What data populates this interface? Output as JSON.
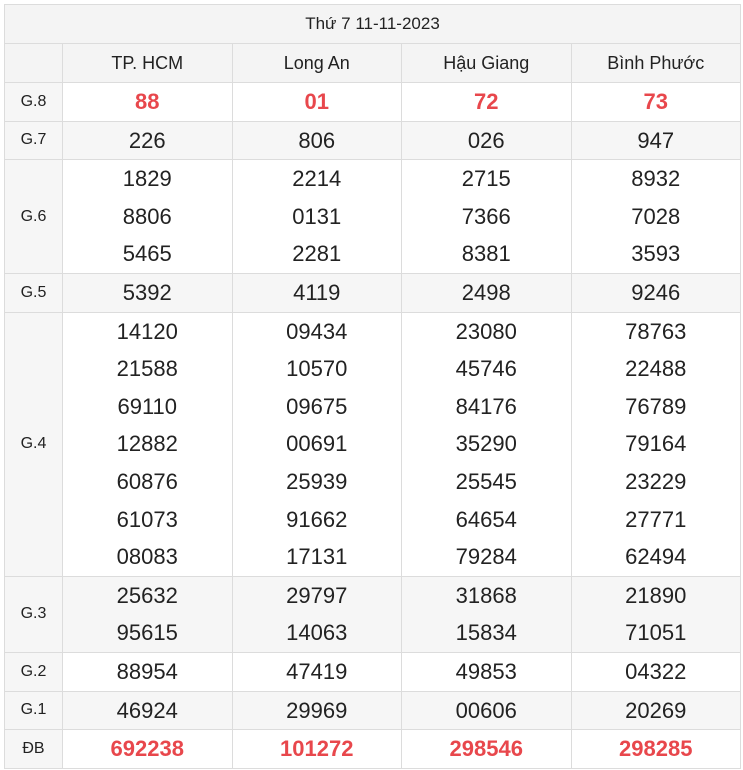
{
  "title": "Thứ 7 11-11-2023",
  "provinces": [
    "TP. HCM",
    "Long An",
    "Hậu Giang",
    "Bình Phước"
  ],
  "prizes": [
    {
      "label": "G.8",
      "special": true,
      "values": [
        [
          "88"
        ],
        [
          "01"
        ],
        [
          "72"
        ],
        [
          "73"
        ]
      ]
    },
    {
      "label": "G.7",
      "values": [
        [
          "226"
        ],
        [
          "806"
        ],
        [
          "026"
        ],
        [
          "947"
        ]
      ]
    },
    {
      "label": "G.6",
      "values": [
        [
          "1829",
          "8806",
          "5465"
        ],
        [
          "2214",
          "0131",
          "2281"
        ],
        [
          "2715",
          "7366",
          "8381"
        ],
        [
          "8932",
          "7028",
          "3593"
        ]
      ]
    },
    {
      "label": "G.5",
      "values": [
        [
          "5392"
        ],
        [
          "4119"
        ],
        [
          "2498"
        ],
        [
          "9246"
        ]
      ]
    },
    {
      "label": "G.4",
      "values": [
        [
          "14120",
          "21588",
          "69110",
          "12882",
          "60876",
          "61073",
          "08083"
        ],
        [
          "09434",
          "10570",
          "09675",
          "00691",
          "25939",
          "91662",
          "17131"
        ],
        [
          "23080",
          "45746",
          "84176",
          "35290",
          "25545",
          "64654",
          "79284"
        ],
        [
          "78763",
          "22488",
          "76789",
          "79164",
          "23229",
          "27771",
          "62494"
        ]
      ]
    },
    {
      "label": "G.3",
      "values": [
        [
          "25632",
          "95615"
        ],
        [
          "29797",
          "14063"
        ],
        [
          "31868",
          "15834"
        ],
        [
          "21890",
          "71051"
        ]
      ]
    },
    {
      "label": "G.2",
      "values": [
        [
          "88954"
        ],
        [
          "47419"
        ],
        [
          "49853"
        ],
        [
          "04322"
        ]
      ]
    },
    {
      "label": "G.1",
      "values": [
        [
          "46924"
        ],
        [
          "29969"
        ],
        [
          "00606"
        ],
        [
          "20269"
        ]
      ]
    },
    {
      "label": "ĐB",
      "special": true,
      "values": [
        [
          "692238"
        ],
        [
          "101272"
        ],
        [
          "298546"
        ],
        [
          "298285"
        ]
      ]
    }
  ],
  "colors": {
    "special": "#e8474c",
    "header_bg": "#f4f4f4",
    "border": "#dcdcdc"
  }
}
